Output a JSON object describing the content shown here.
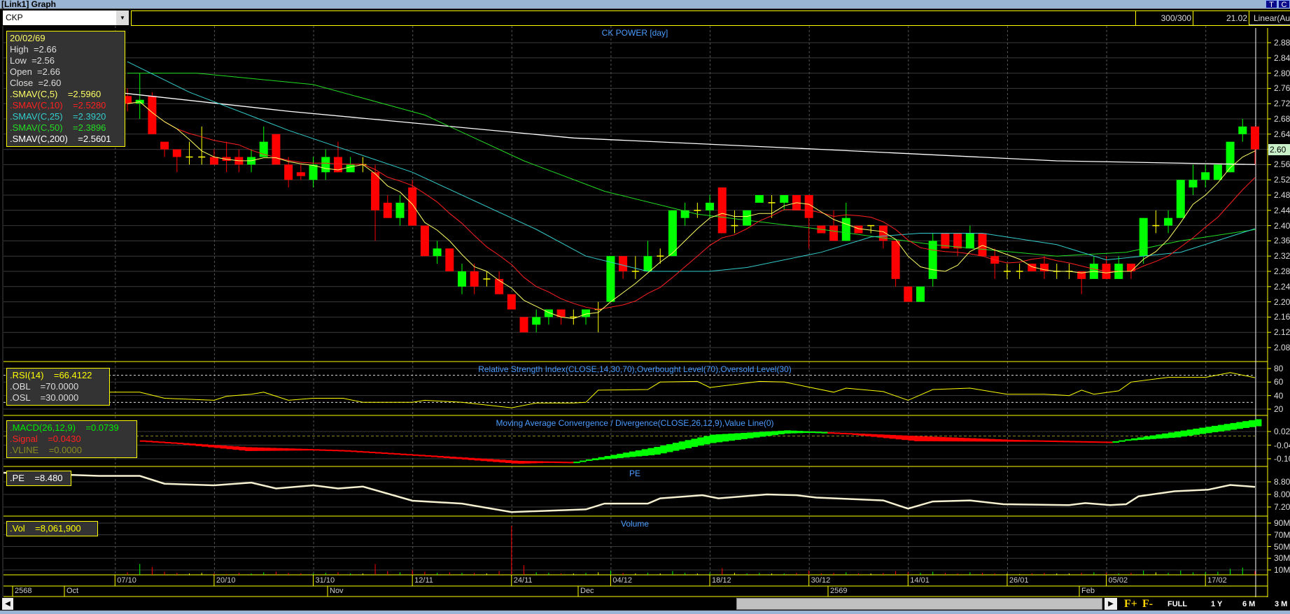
{
  "window": {
    "title": "[Link1] Graph",
    "btn_t": "T",
    "btn_c": "C"
  },
  "toolbar": {
    "symbol": "CKP",
    "bars": "300/300",
    "value": "21.02",
    "scale": "Linear(Au"
  },
  "price": {
    "title": "CK POWER [day]",
    "info": {
      "date": "20/02/69",
      "high": "High  =2.66",
      "low": "Low  =2.56",
      "open": "Open  =2.66",
      "close": "Close  =2.60",
      "sma5": ".SMAV(C,5)    =2.5960",
      "sma10": ".SMAV(C,10)    =2.5280",
      "sma25": ".SMAV(C,25)    =2.3920",
      "sma50": ".SMAV(C,50)    =2.3896",
      "sma200": ".SMAV(C,200)    =2.5601"
    },
    "axis_labels": [
      "2.88",
      "2.84",
      "2.80",
      "2.76",
      "2.72",
      "2.68",
      "2.64",
      "2.60",
      "2.56",
      "2.52",
      "2.48",
      "2.44",
      "2.40",
      "2.36",
      "2.32",
      "2.28",
      "2.24",
      "2.20",
      "2.16",
      "2.12",
      "2.08"
    ],
    "last_tag": "2.60"
  },
  "rsi": {
    "title": "Relative Strength Index(CLOSE,14,30,70),Overbought Level(70),Oversold Level(30)",
    "info": {
      "rsi": ".RSI(14)    =66.4122",
      "obl": ".OBL    =70.0000",
      "osl": ".OSL    =30.0000"
    },
    "axis_labels": [
      "80",
      "60",
      "40",
      "20"
    ]
  },
  "macd": {
    "title": "Moving Average Convergence / Divergence(CLOSE,26,12,9),Value Line(0)",
    "info": {
      "macd": ".MACD(26,12,9)    =0.0739",
      "signal": ".Signal    =0.0430",
      "vline": ".VLINE    =0.0000"
    },
    "axis_labels": [
      "0.02",
      "-0.04",
      "-0.10"
    ]
  },
  "pe": {
    "title": "PE",
    "info": ".PE    =8.480",
    "axis_labels": [
      "8.80",
      "8.00",
      "7.20"
    ]
  },
  "volume": {
    "title": "Volume",
    "info": ".Vol    =8,061,900",
    "axis_labels": [
      "90M",
      "70M",
      "50M",
      "30M",
      "10M"
    ]
  },
  "dates": [
    "07/10",
    "20/10",
    "31/10",
    "12/11",
    "24/11",
    "04/12",
    "18/12",
    "30/12",
    "14/01",
    "26/01",
    "05/02",
    "17/02"
  ],
  "months": [
    "2568",
    "Oct",
    "Nov",
    "Dec",
    "2569",
    "Feb"
  ],
  "nav": {
    "fplus": "F+",
    "fminus": "F-",
    "full": "FULL",
    "y1": "1 Y",
    "m6": "6 M",
    "m3": "3 M"
  },
  "colors": {
    "up": "#00ff00",
    "down": "#ff0000",
    "doji": "#ffff00",
    "sma5": "#ffff66",
    "sma10": "#ff2020",
    "sma25": "#33cccc",
    "sma50": "#22dd22",
    "sma200": "#ffffff",
    "panel_border": "#ffff00",
    "title": "#4a9cff"
  },
  "chart_data": {
    "type": "candlestick",
    "title": "CK POWER [day]",
    "ylim": [
      2.08,
      2.88
    ],
    "date_ticks_index": [
      -1,
      7,
      15,
      23,
      31,
      39,
      47,
      55,
      63,
      71,
      79,
      87
    ],
    "ohlc": [
      [
        2.74,
        2.76,
        2.7,
        2.72
      ],
      [
        2.72,
        2.8,
        2.68,
        2.73
      ],
      [
        2.74,
        2.75,
        2.64,
        2.64
      ],
      [
        2.62,
        2.62,
        2.58,
        2.6
      ],
      [
        2.6,
        2.6,
        2.54,
        2.58
      ],
      [
        2.58,
        2.62,
        2.56,
        2.58
      ],
      [
        2.58,
        2.66,
        2.56,
        2.58
      ],
      [
        2.58,
        2.6,
        2.56,
        2.56
      ],
      [
        2.58,
        2.62,
        2.54,
        2.57
      ],
      [
        2.58,
        2.6,
        2.54,
        2.56
      ],
      [
        2.56,
        2.6,
        2.54,
        2.58
      ],
      [
        2.58,
        2.66,
        2.58,
        2.62
      ],
      [
        2.64,
        2.64,
        2.56,
        2.56
      ],
      [
        2.56,
        2.58,
        2.5,
        2.52
      ],
      [
        2.54,
        2.56,
        2.52,
        2.53
      ],
      [
        2.52,
        2.58,
        2.5,
        2.56
      ],
      [
        2.54,
        2.6,
        2.52,
        2.58
      ],
      [
        2.58,
        2.62,
        2.54,
        2.54
      ],
      [
        2.54,
        2.58,
        2.54,
        2.56
      ],
      [
        2.56,
        2.58,
        2.54,
        2.56
      ],
      [
        2.54,
        2.56,
        2.36,
        2.44
      ],
      [
        2.46,
        2.48,
        2.42,
        2.42
      ],
      [
        2.42,
        2.48,
        2.4,
        2.46
      ],
      [
        2.5,
        2.52,
        2.4,
        2.4
      ],
      [
        2.4,
        2.4,
        2.32,
        2.32
      ],
      [
        2.32,
        2.36,
        2.3,
        2.34
      ],
      [
        2.34,
        2.34,
        2.28,
        2.28
      ],
      [
        2.24,
        2.3,
        2.22,
        2.28
      ],
      [
        2.28,
        2.3,
        2.22,
        2.24
      ],
      [
        2.26,
        2.28,
        2.24,
        2.26
      ],
      [
        2.26,
        2.28,
        2.22,
        2.22
      ],
      [
        2.22,
        2.22,
        2.18,
        2.18
      ],
      [
        2.16,
        2.16,
        2.12,
        2.12
      ],
      [
        2.14,
        2.18,
        2.12,
        2.16
      ],
      [
        2.16,
        2.18,
        2.14,
        2.18
      ],
      [
        2.18,
        2.18,
        2.14,
        2.16
      ],
      [
        2.16,
        2.18,
        2.14,
        2.16
      ],
      [
        2.16,
        2.18,
        2.14,
        2.18
      ],
      [
        2.18,
        2.2,
        2.12,
        2.18
      ],
      [
        2.2,
        2.32,
        2.2,
        2.32
      ],
      [
        2.32,
        2.32,
        2.26,
        2.28
      ],
      [
        2.28,
        2.32,
        2.26,
        2.28
      ],
      [
        2.28,
        2.36,
        2.28,
        2.32
      ],
      [
        2.32,
        2.34,
        2.3,
        2.32
      ],
      [
        2.32,
        2.44,
        2.32,
        2.44
      ],
      [
        2.42,
        2.46,
        2.4,
        2.44
      ],
      [
        2.44,
        2.46,
        2.42,
        2.44
      ],
      [
        2.44,
        2.48,
        2.42,
        2.46
      ],
      [
        2.5,
        2.5,
        2.38,
        2.38
      ],
      [
        2.4,
        2.44,
        2.38,
        2.4
      ],
      [
        2.4,
        2.44,
        2.4,
        2.44
      ],
      [
        2.46,
        2.48,
        2.46,
        2.48
      ],
      [
        2.46,
        2.48,
        2.42,
        2.46
      ],
      [
        2.46,
        2.48,
        2.44,
        2.48
      ],
      [
        2.48,
        2.48,
        2.44,
        2.44
      ],
      [
        2.48,
        2.48,
        2.34,
        2.42
      ],
      [
        2.4,
        2.4,
        2.38,
        2.38
      ],
      [
        2.4,
        2.44,
        2.36,
        2.36
      ],
      [
        2.36,
        2.46,
        2.36,
        2.42
      ],
      [
        2.4,
        2.4,
        2.38,
        2.38
      ],
      [
        2.4,
        2.4,
        2.38,
        2.4
      ],
      [
        2.4,
        2.4,
        2.34,
        2.36
      ],
      [
        2.36,
        2.36,
        2.24,
        2.26
      ],
      [
        2.24,
        2.24,
        2.2,
        2.2
      ],
      [
        2.2,
        2.24,
        2.2,
        2.24
      ],
      [
        2.26,
        2.38,
        2.24,
        2.36
      ],
      [
        2.38,
        2.38,
        2.34,
        2.34
      ],
      [
        2.38,
        2.38,
        2.32,
        2.34
      ],
      [
        2.34,
        2.4,
        2.34,
        2.38
      ],
      [
        2.38,
        2.38,
        2.32,
        2.32
      ],
      [
        2.32,
        2.34,
        2.26,
        2.3
      ],
      [
        2.28,
        2.3,
        2.26,
        2.28
      ],
      [
        2.28,
        2.3,
        2.26,
        2.28
      ],
      [
        2.3,
        2.3,
        2.28,
        2.28
      ],
      [
        2.3,
        2.32,
        2.26,
        2.28
      ],
      [
        2.28,
        2.3,
        2.26,
        2.28
      ],
      [
        2.28,
        2.3,
        2.26,
        2.28
      ],
      [
        2.28,
        2.28,
        2.22,
        2.26
      ],
      [
        2.26,
        2.32,
        2.26,
        2.3
      ],
      [
        2.3,
        2.32,
        2.26,
        2.26
      ],
      [
        2.26,
        2.32,
        2.26,
        2.3
      ],
      [
        2.3,
        2.3,
        2.26,
        2.28
      ],
      [
        2.32,
        2.42,
        2.3,
        2.42
      ],
      [
        2.4,
        2.44,
        2.38,
        2.4
      ],
      [
        2.4,
        2.44,
        2.38,
        2.42
      ],
      [
        2.42,
        2.52,
        2.42,
        2.52
      ],
      [
        2.5,
        2.56,
        2.48,
        2.52
      ],
      [
        2.52,
        2.56,
        2.5,
        2.54
      ],
      [
        2.52,
        2.56,
        2.52,
        2.56
      ],
      [
        2.54,
        2.62,
        2.54,
        2.62
      ],
      [
        2.64,
        2.68,
        2.62,
        2.66
      ],
      [
        2.66,
        2.66,
        2.56,
        2.6
      ]
    ],
    "sma25": [
      [
        0,
        2.83
      ],
      [
        5,
        2.75
      ],
      [
        13,
        2.65
      ],
      [
        23,
        2.54
      ],
      [
        33,
        2.39
      ],
      [
        37,
        2.32
      ],
      [
        42,
        2.28
      ],
      [
        47,
        2.28
      ],
      [
        50,
        2.29
      ],
      [
        56,
        2.33
      ],
      [
        60,
        2.37
      ],
      [
        64,
        2.38
      ],
      [
        69,
        2.38
      ],
      [
        75,
        2.35
      ],
      [
        79,
        2.31
      ],
      [
        85,
        2.33
      ],
      [
        91,
        2.392
      ]
    ],
    "sma50": [
      [
        0,
        2.8
      ],
      [
        5.6,
        2.8
      ],
      [
        15,
        2.77
      ],
      [
        24,
        2.69
      ],
      [
        32,
        2.57
      ],
      [
        38.5,
        2.49
      ],
      [
        46,
        2.43
      ],
      [
        56,
        2.39
      ],
      [
        65,
        2.35
      ],
      [
        75,
        2.32
      ],
      [
        80.6,
        2.33
      ],
      [
        85,
        2.36
      ],
      [
        91,
        2.3896
      ]
    ],
    "sma200": [
      [
        -1,
        2.75
      ],
      [
        13,
        2.7
      ],
      [
        36,
        2.63
      ],
      [
        56,
        2.6
      ],
      [
        75,
        2.57
      ],
      [
        91,
        2.5601
      ]
    ],
    "rsi": [
      [
        -2,
        45
      ],
      [
        1,
        45
      ],
      [
        3,
        36
      ],
      [
        7,
        33
      ],
      [
        8,
        39
      ],
      [
        10,
        42
      ],
      [
        11,
        45
      ],
      [
        13,
        33
      ],
      [
        15,
        36
      ],
      [
        17.4,
        36
      ],
      [
        19,
        30
      ],
      [
        23,
        30
      ],
      [
        24,
        33
      ],
      [
        27,
        30
      ],
      [
        31,
        22
      ],
      [
        33,
        29
      ],
      [
        36,
        29
      ],
      [
        37,
        30
      ],
      [
        38,
        48
      ],
      [
        42,
        49
      ],
      [
        43,
        60
      ],
      [
        46,
        61
      ],
      [
        47,
        52
      ],
      [
        51,
        61
      ],
      [
        53,
        60
      ],
      [
        57,
        45
      ],
      [
        58,
        51
      ],
      [
        61,
        46
      ],
      [
        63,
        33
      ],
      [
        65,
        49
      ],
      [
        68,
        51
      ],
      [
        71,
        42
      ],
      [
        74,
        42
      ],
      [
        76,
        40
      ],
      [
        77,
        48
      ],
      [
        78,
        42
      ],
      [
        80,
        47
      ],
      [
        81,
        60
      ],
      [
        84,
        67
      ],
      [
        87,
        67
      ],
      [
        89,
        74
      ],
      [
        91,
        66.41
      ]
    ],
    "macd": [
      [
        0.7,
        -0.018
      ],
      [
        9.5,
        -0.066
      ],
      [
        17.4,
        -0.062
      ],
      [
        31.3,
        -0.122
      ],
      [
        35.9,
        -0.114
      ],
      [
        42.4,
        -0.049
      ],
      [
        47,
        0.006
      ],
      [
        53,
        0.025
      ],
      [
        56.3,
        0.017
      ],
      [
        63.5,
        -0.023
      ],
      [
        71.4,
        -0.025
      ],
      [
        79.3,
        -0.025
      ],
      [
        84.5,
        0.02
      ],
      [
        91,
        0.0739
      ]
    ],
    "signal": [
      [
        0.7,
        -0.018
      ],
      [
        9.5,
        -0.049
      ],
      [
        17.4,
        -0.062
      ],
      [
        31.3,
        -0.109
      ],
      [
        35.9,
        -0.114
      ],
      [
        42.4,
        -0.083
      ],
      [
        47,
        -0.031
      ],
      [
        53,
        0.011
      ],
      [
        56.3,
        0.017
      ],
      [
        63.5,
        0.0
      ],
      [
        71.4,
        -0.017
      ],
      [
        79.3,
        -0.025
      ],
      [
        84.5,
        -0.006
      ],
      [
        91,
        0.043
      ]
    ],
    "vline": 0,
    "pe": [
      [
        -10,
        9.38
      ],
      [
        -2.3,
        9.18
      ],
      [
        1,
        9.18
      ],
      [
        3,
        8.68
      ],
      [
        7,
        8.58
      ],
      [
        10,
        8.75
      ],
      [
        12,
        8.38
      ],
      [
        15,
        8.58
      ],
      [
        17,
        8.38
      ],
      [
        19,
        8.5
      ],
      [
        23,
        7.6
      ],
      [
        27,
        7.42
      ],
      [
        31,
        6.88
      ],
      [
        37,
        7.05
      ],
      [
        38.5,
        7.42
      ],
      [
        42,
        7.42
      ],
      [
        43,
        7.75
      ],
      [
        46.4,
        7.95
      ],
      [
        47.7,
        7.75
      ],
      [
        51.6,
        8.0
      ],
      [
        54,
        7.95
      ],
      [
        55.6,
        7.8
      ],
      [
        61,
        7.62
      ],
      [
        63,
        7.1
      ],
      [
        65,
        7.55
      ],
      [
        68,
        7.62
      ],
      [
        70.7,
        7.38
      ],
      [
        76,
        7.32
      ],
      [
        77.3,
        7.45
      ],
      [
        79.3,
        7.32
      ],
      [
        80.6,
        7.38
      ],
      [
        81.6,
        7.88
      ],
      [
        84.5,
        8.2
      ],
      [
        87.2,
        8.3
      ],
      [
        89,
        8.6
      ],
      [
        91,
        8.48
      ]
    ],
    "volume_m": [
      6,
      20,
      15,
      7,
      5,
      4,
      5,
      4,
      3,
      5,
      4,
      6,
      7,
      5,
      4,
      4,
      5,
      6,
      4,
      4,
      20,
      8,
      6,
      10,
      7,
      5,
      6,
      5,
      5,
      4,
      8,
      85,
      18,
      6,
      5,
      4,
      4,
      5,
      6,
      9,
      5,
      4,
      5,
      4,
      8,
      5,
      4,
      5,
      13,
      5,
      4,
      5,
      4,
      4,
      5,
      9,
      4,
      5,
      6,
      4,
      4,
      5,
      8,
      6,
      5,
      7,
      5,
      4,
      6,
      5,
      4,
      4,
      3,
      4,
      5,
      4,
      4,
      5,
      6,
      5,
      4,
      5,
      9,
      6,
      5,
      9,
      6,
      6,
      7,
      12,
      14,
      8.06
    ]
  }
}
